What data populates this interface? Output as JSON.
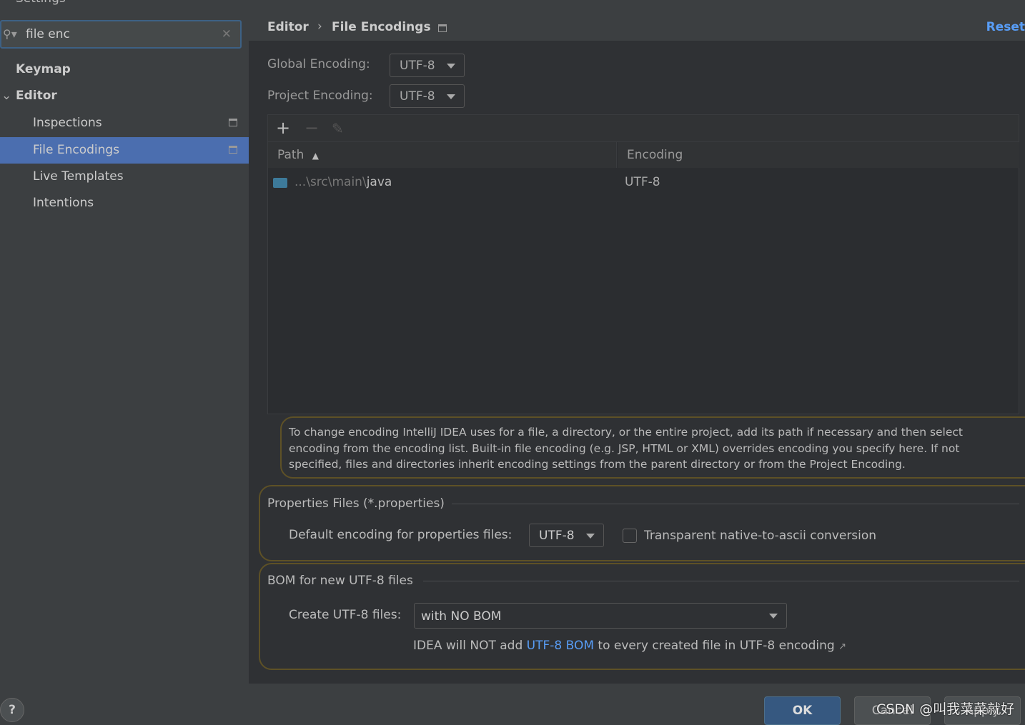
{
  "window": {
    "title": "Settings"
  },
  "search": {
    "value": "file enc"
  },
  "sidebar": {
    "items": [
      {
        "label": "Keymap"
      },
      {
        "label": "Editor"
      },
      {
        "label": "Inspections"
      },
      {
        "label": "File Encodings"
      },
      {
        "label": "Live Templates"
      },
      {
        "label": "Intentions"
      }
    ]
  },
  "header": {
    "crumb1": "Editor",
    "crumb2": "File Encodings",
    "reset": "Reset"
  },
  "global": {
    "label": "Global Encoding:",
    "value": "UTF-8"
  },
  "project": {
    "label": "Project Encoding:",
    "value": "UTF-8"
  },
  "table": {
    "columns": [
      "Path",
      "Encoding"
    ],
    "rows": [
      {
        "path_prefix": "...\\src\\main\\",
        "path_last": "java",
        "encoding": "UTF-8"
      }
    ]
  },
  "info": "To change encoding IntelliJ IDEA uses for a file, a directory, or the entire project, add its path if necessary and then select encoding from the encoding list. Built-in file encoding (e.g. JSP, HTML or XML) overrides encoding you specify here. If not specified, files and directories inherit encoding settings from the parent directory or from the Project Encoding.",
  "props": {
    "title": "Properties Files (*.properties)",
    "label": "Default encoding for properties files:",
    "value": "UTF-8",
    "checkbox": "Transparent native-to-ascii conversion",
    "checked": false
  },
  "bom": {
    "title": "BOM for new UTF-8 files",
    "label": "Create UTF-8 files:",
    "value": "with NO BOM",
    "hint_pre": "IDEA will NOT add ",
    "hint_link": "UTF-8 BOM",
    "hint_post": " to every created file in UTF-8 encoding"
  },
  "footer": {
    "help": "?",
    "ok": "OK",
    "cancel": "Cancel",
    "apply": "Apply",
    "watermark": "CSDN @叫我菜菜就好"
  },
  "colors": {
    "accent": "#4b6eaf",
    "link": "#589df6",
    "ok": "#365880"
  }
}
